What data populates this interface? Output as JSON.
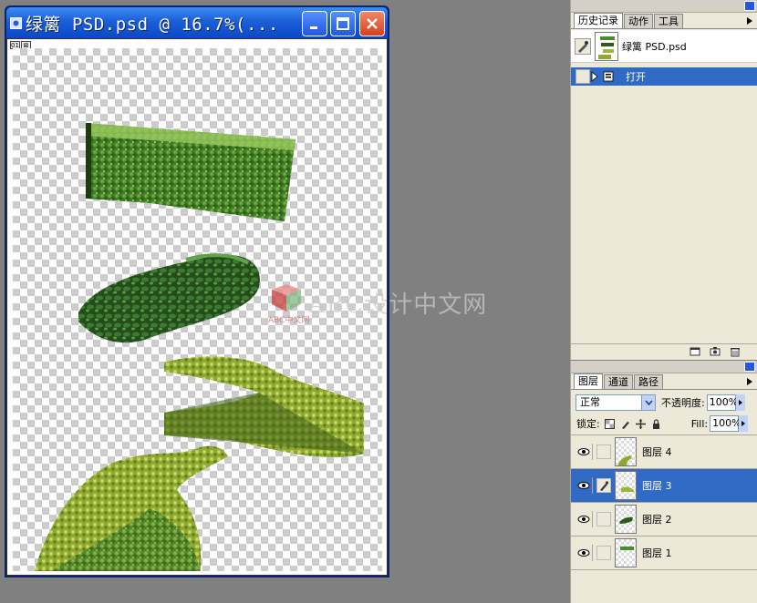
{
  "document": {
    "title": "绿篱 PSD.psd @ 16.7%(...",
    "ruler_tags": [
      "01",
      "⊠"
    ]
  },
  "watermark": {
    "text": "ABC设计中文网",
    "small": "ABC中文网"
  },
  "history_panel": {
    "tabs": [
      "历史记录",
      "动作",
      "工具"
    ],
    "active_tab": 0,
    "snapshot_name": "绿篱 PSD.psd",
    "states": [
      {
        "label": "打开",
        "selected": true
      }
    ]
  },
  "layers_panel": {
    "tabs": [
      "图层",
      "通道",
      "路径"
    ],
    "active_tab": 0,
    "blend_mode": "正常",
    "opacity_label": "不透明度:",
    "opacity_value": "100%",
    "lock_label": "锁定:",
    "fill_label": "Fill:",
    "fill_value": "100%",
    "layers": [
      {
        "name": "图层 4",
        "visible": true,
        "selected": false
      },
      {
        "name": "图层 3",
        "visible": true,
        "selected": true
      },
      {
        "name": "图层 2",
        "visible": true,
        "selected": false
      },
      {
        "name": "图层 1",
        "visible": true,
        "selected": false
      }
    ]
  },
  "colors": {
    "titlebar": "#0b48c8",
    "selection": "#316ac5",
    "panel_bg": "#ece9d8",
    "workspace": "#808080"
  }
}
